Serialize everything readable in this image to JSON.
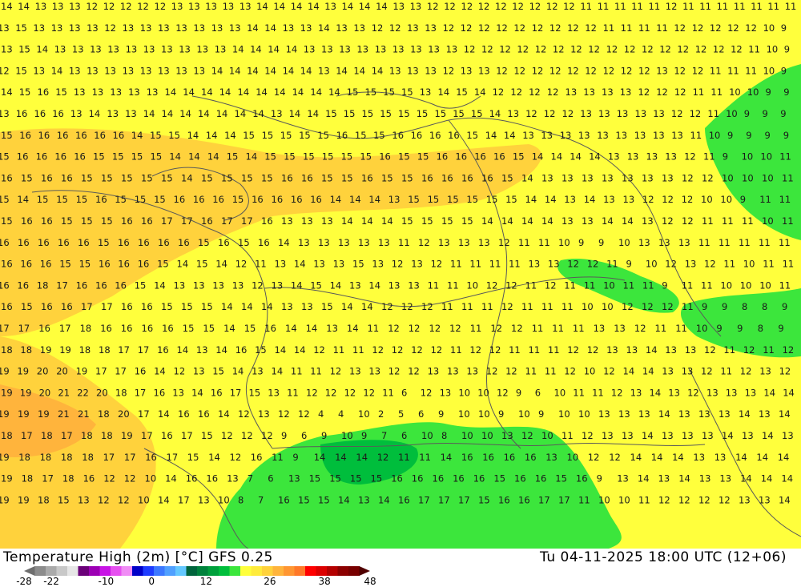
{
  "title": "Temperature High (2m) [°C] GFS 0.25",
  "valid_time": "Tu 04-11-2025 18:00 UTC (12+06)",
  "legend": {
    "tick_labels": [
      "-28",
      "-22",
      "-10",
      "0",
      "12",
      "26",
      "38",
      "48"
    ],
    "tick_values": [
      -28,
      -22,
      -10,
      0,
      12,
      26,
      38,
      48
    ],
    "range": [
      -28,
      48
    ],
    "colors": [
      "#6e6e6e",
      "#8c8c8c",
      "#aaaaaa",
      "#c8c8c8",
      "#e6e6e6",
      "#6a0078",
      "#9c00b4",
      "#c814e6",
      "#e650f0",
      "#f08cf5",
      "#0000c8",
      "#1e3cff",
      "#3c78ff",
      "#50a0ff",
      "#64c8ff",
      "#00643c",
      "#00823c",
      "#00a03c",
      "#00be3c",
      "#3ce63c",
      "#ffff3c",
      "#ffeb3c",
      "#ffd23c",
      "#ffb43c",
      "#ff9632",
      "#ff7828",
      "#ff0000",
      "#dc0000",
      "#b40000",
      "#8c0000",
      "#780000",
      "#500000"
    ]
  },
  "map_colors": {
    "base": "#ffff3c",
    "green": "#3ce63c",
    "green_dark": "#00be3c",
    "orange": "#ffd23c",
    "borders": "#5a5a5a"
  },
  "grid_rows": [
    "14 14 13 13 13 12 12 12 12 12 13 13 13 13 13 14 14 14 14 13 14 14 14 13 13 12 12 12 12 12 12 12 12 12 11 11 11 11 11 12 11 11 11 11 11 11 11",
    "13 15 13 13 13 13 12 13 13 13 13 13 13 13 14 14 13 13 14 13 13 12 12 13 13 12 12 12 12 12 12 12 12 12 11 11 11 11 12 12 12 12 12 10 9",
    "13 15 14 13 13 13 13 13 13 13 13 13 13 14 14 14 14 13 13 13 13 13 13 13 13 13 12 12 12 12 12 12 12 12 12 12 12 12 12 12 12 12 11 10 9",
    "12 15 13 14 13 13 13 13 13 13 13 13 14 14 14 14 14 14 13 14 14 14 13 13 13 12 13 13 12 12 12 12 12 12 12 12 12 13 12 12 11 11 11 10 9",
    "14 15 16 15 13 13 13 13 13 14 14 14 14 14 14 14 14 14 14 15 15 15 15 13 14 15 14 12 12 12 12 13 13 13 13 12 12 12 11 11 10 10 9 9",
    "13 16 16 16 13 14 13 13 14 14 14 14 14 14 14 13 14 14 15 15 15 15 15 15 15 15 15 14 13 12 12 12 13 13 13 13 13 12 12 11 10 9 9 9",
    "15 16 16 16 16 16 16 14 15 15 14 14 14 15 15 15 15 15 16 15 15 16 16 16 16 15 14 14 13 13 13 13 13 13 13 13 13 11 10 9 9 9 9",
    "15 16 16 16 16 15 15 15 15 14 14 14 15 14 15 15 15 15 15 15 16 15 15 16 16 16 16 15 14 14 14 14 13 13 13 13 12 11 9 10 10 11",
    "16 15 16 16 15 15 15 15 15 14 15 15 15 15 16 16 15 15 16 15 15 16 16 16 16 15 14 13 13 13 13 13 13 13 12 12 10 10 10 11",
    "15 14 15 15 15 16 15 15 15 16 16 16 15 16 16 16 16 14 14 14 13 15 15 15 15 15 15 14 14 13 14 13 13 12 12 12 10 10 9 11 11",
    "15 16 16 15 15 15 16 16 17 17 16 17 17 16 13 13 13 14 14 14 15 15 15 15 14 14 14 14 13 13 14 14 13 12 12 11 11 11 10 11",
    "16 16 16 16 16 15 16 16 16 16 15 16 15 16 14 13 13 13 13 13 11 12 13 13 13 12 11 11 10 9 9 10 13 13 13 11 11 11 11 11",
    "16 16 16 15 15 16 16 16 15 14 15 14 12 11 13 14 13 13 15 13 12 13 12 11 11 11 11 13 13 12 12 11 9 10 12 13 12 11 10 11 11",
    "16 16 18 17 16 16 16 15 14 13 13 13 13 12 13 14 15 14 13 14 13 13 11 11 10 12 12 11 12 11 11 10 11 11 9 11 11 10 10 10 11",
    "16 15 16 16 17 17 16 16 15 15 15 14 14 14 13 13 15 14 14 12 12 12 11 11 11 12 11 11 11 10 10 12 12 12 11 9 9 8 8 9",
    "17 17 16 17 18 16 16 16 16 15 15 14 15 16 14 14 13 14 11 12 12 12 12 11 12 12 11 11 11 13 13 12 11 11 10 9 9 8 9",
    "18 18 19 19 18 18 17 17 16 14 13 14 16 15 14 14 12 11 11 12 12 12 12 11 12 12 11 11 11 12 12 13 13 14 13 13 12 11 12 11 12",
    "19 19 20 20 19 17 17 16 14 12 13 15 14 13 14 11 11 12 13 13 12 12 13 13 13 12 12 11 11 12 10 12 14 14 13 13 12 11 12 13 12",
    "19 19 20 21 22 20 18 17 16 13 14 16 17 15 13 11 12 12 12 12 11 6 12 13 10 10 12 9 6 10 11 11 12 13 14 13 12 13 13 13 14 14",
    "19 19 19 21 21 18 20 17 14 16 16 14 12 13 12 12 4 4 10 2 5 6 9 10 10 9 10 9 10 10 13 13 13 14 13 13 13 14 13 14",
    "18 17 18 17 18 18 19 17 16 17 15 12 12 12 9 6 9 10 9 7 6 10 8 10 10 13 12 10 11 12 13 13 14 13 13 13 14 13 14 13",
    "19 18 18 18 18 17 17 16 17 15 14 12 16 11 9 14 14 14 12 11 11 14 16 16 16 16 13 10 12 12 14 14 14 13 13 14 14 14",
    "19 18 17 18 16 12 12 10 14 16 16 13 7 6 13 15 15 15 15 16 16 16 16 16 15 16 16 15 16 9 13 14 13 14 13 13 14 14 14",
    "19 19 18 15 13 12 12 10 14 17 13 10 8 7 16 15 15 14 13 14 16 17 17 17 15 16 16 17 17 11 10 10 11 12 12 12 12 13 13 14"
  ]
}
